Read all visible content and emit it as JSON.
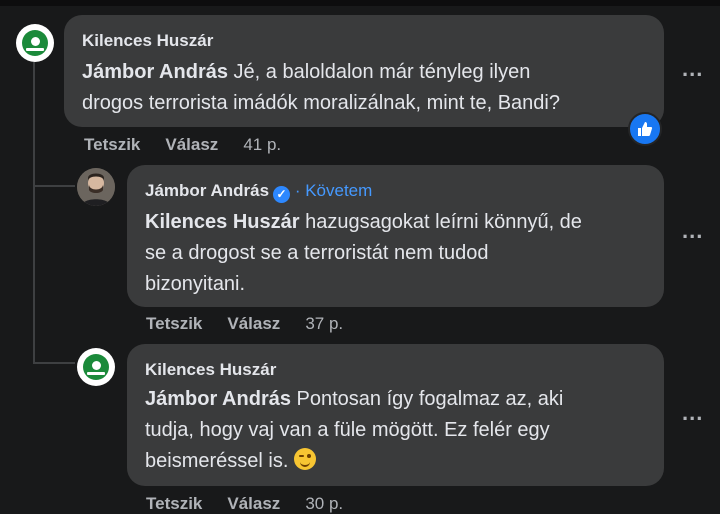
{
  "comments": [
    {
      "author": "Kilences Huszár",
      "mention": "Jámbor András",
      "text_lines": [
        " Jé, a baloldalon már tényleg ilyen",
        "drogos terrorista imádók moralizálnak, mint te, Bandi?"
      ],
      "actions": {
        "like": "Tetszik",
        "reply": "Válasz",
        "time": "41 p."
      }
    },
    {
      "author": "Jámbor András",
      "follow_label": "Követem",
      "mention": "Kilences Huszár",
      "text_lines": [
        " hazugsagokat leírni könnyű, de",
        "se a drogost se a terroristát nem tudod",
        "bizonyitani."
      ],
      "actions": {
        "like": "Tetszik",
        "reply": "Válasz",
        "time": "37 p."
      }
    },
    {
      "author": "Kilences Huszár",
      "mention": "Jámbor András",
      "text_lines": [
        " Pontosan így fogalmaz az, aki",
        "tudja, hogy vaj van a füle mögött. Ez felér egy",
        "beismeréssel is."
      ],
      "actions": {
        "like": "Tetszik",
        "reply": "Válasz",
        "time": "30 p."
      }
    }
  ],
  "more_options": "..."
}
